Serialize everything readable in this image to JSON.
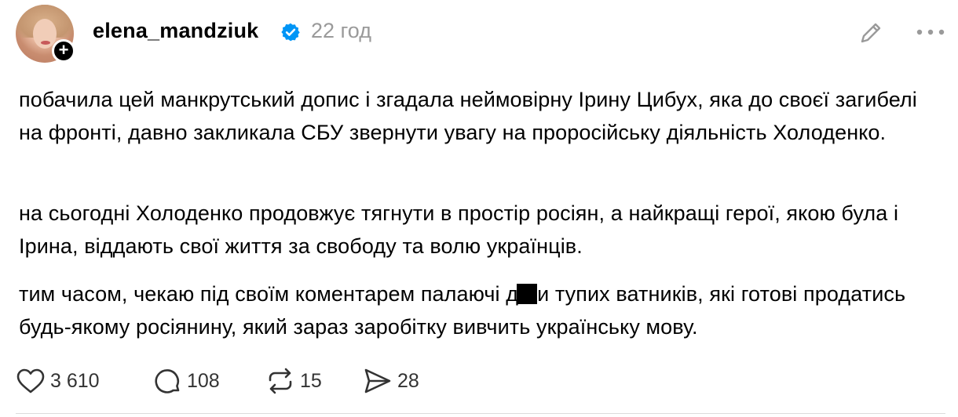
{
  "post": {
    "username": "elena_mandziuk",
    "timestamp": "22 год",
    "paragraphs": {
      "p1": "побачила цей манкрутський допис і згадала неймовірну Ірину Цибух, яка до своєї загибелі на фронті, давно закликала СБУ звернути увагу на проросійську діяльність Холоденко.",
      "p2": "на сьогодні Холоденко продовжує тягнути в простір росіян, а найкращі герої, якою була і Ірина, віддають свої життя за свободу та волю українців.",
      "p3_before": "тим часом, чекаю під своїм коментарем палаючі д",
      "p3_after": "и тупих ватників, які готові продатись будь-якому росіянину, який зараз заробітку вивчить українську мову."
    },
    "actions": {
      "likes": "3 610",
      "comments": "108",
      "reposts": "15",
      "shares": "28"
    }
  },
  "icons": {
    "follow": "plus-icon",
    "verified": "verified-badge-icon",
    "edit": "pencil-icon",
    "more": "more-horizontal-icon",
    "like": "heart-icon",
    "comment": "comment-bubble-icon",
    "repost": "repost-icon",
    "share": "send-icon"
  },
  "colors": {
    "verified": "#0095f6",
    "secondary_text": "#9a9a9a",
    "divider": "#dcdcdc"
  }
}
